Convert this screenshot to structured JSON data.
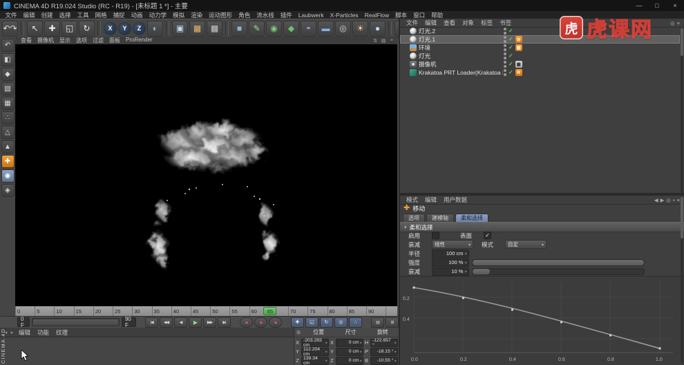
{
  "window": {
    "title": "CINEMA 4D R19.024 Studio (RC - R19) - [未标题 1 *] - 主要",
    "controls": [
      {
        "name": "minimize-button",
        "glyph": "—"
      },
      {
        "name": "maximize-button",
        "glyph": "□"
      },
      {
        "name": "close-button",
        "glyph": "×"
      }
    ]
  },
  "menu_bar": {
    "items": [
      "文件",
      "编辑",
      "创建",
      "选择",
      "工具",
      "网格",
      "捕捉",
      "动画",
      "动力学",
      "模拟",
      "渲染",
      "运动图形",
      "角色",
      "流水线",
      "插件",
      "Laubwerk",
      "X-Particles",
      "RealFlow",
      "脚本",
      "窗口",
      "帮助"
    ]
  },
  "toolbar": {
    "icons": [
      {
        "name": "undo-redo-button",
        "glyph": "↶↷",
        "color": "#dcdcdc"
      },
      {
        "sep": true
      },
      {
        "name": "live-selection-button",
        "glyph": "↖",
        "color": "#ececec"
      },
      {
        "name": "move-tool-button",
        "glyph": "✚",
        "color": "#ececec"
      },
      {
        "name": "scale-tool-button",
        "glyph": "◱",
        "color": "#ececec"
      },
      {
        "name": "rotate-tool-button",
        "glyph": "↻",
        "color": "#ececec"
      },
      {
        "sep": true
      },
      {
        "name": "x-axis-lock-button",
        "glyph": "X",
        "kind": "round"
      },
      {
        "name": "y-axis-lock-button",
        "glyph": "Y",
        "kind": "round"
      },
      {
        "name": "z-axis-lock-button",
        "glyph": "Z",
        "kind": "round"
      },
      {
        "name": "coordinate-system-button",
        "glyph": "◐",
        "color": "#8fc3ea"
      },
      {
        "sep": true
      },
      {
        "name": "render-view-button",
        "glyph": "▣",
        "color": "#bcd9f0"
      },
      {
        "name": "render-picture-viewer-button",
        "glyph": "▦",
        "color": "#e3bb72"
      },
      {
        "name": "render-settings-button",
        "glyph": "▩",
        "color": "#c8c8c8"
      },
      {
        "sep": true
      },
      {
        "name": "add-cube-button",
        "glyph": "■",
        "color": "#8ab4dd"
      },
      {
        "name": "add-spline-button",
        "glyph": "✎",
        "color": "#9fd89f"
      },
      {
        "name": "add-subdivision-button",
        "glyph": "◉",
        "color": "#7ecb7e"
      },
      {
        "name": "add-generator-button",
        "glyph": "◆",
        "color": "#6fbf6f"
      },
      {
        "name": "add-deformer-button",
        "glyph": "◓",
        "color": "#b49ae0"
      },
      {
        "name": "add-floor-button",
        "glyph": "▬",
        "color": "#7fb2e8"
      },
      {
        "name": "add-camera-button",
        "glyph": "◎",
        "color": "#d8d8d8"
      },
      {
        "name": "add-light-button",
        "glyph": "☀",
        "color": "#f2dc8a"
      },
      {
        "name": "add-material-button",
        "glyph": "●",
        "color": "#bcd8f2"
      },
      {
        "sep": true
      },
      {
        "name": "snap-settings-button",
        "glyph": "▦",
        "color": "#e08a8a"
      },
      {
        "name": "grid-settings-button",
        "glyph": "▦",
        "color": "#8ad08a"
      },
      {
        "name": "paint-setup-button",
        "glyph": "✎",
        "color": "#e8c48a"
      }
    ]
  },
  "left_toolbar": {
    "icons": [
      {
        "name": "undo-icon",
        "glyph": "↶"
      },
      {
        "name": "convert-editable-icon",
        "glyph": "◧"
      },
      {
        "name": "model-mode-icon",
        "glyph": "◆"
      },
      {
        "name": "texture-mode-icon",
        "glyph": "▨"
      },
      {
        "name": "workplane-icon",
        "glyph": "▦"
      },
      {
        "name": "points-mode-icon",
        "glyph": "∴"
      },
      {
        "name": "edges-mode-icon",
        "glyph": "△"
      },
      {
        "name": "polygons-mode-icon",
        "glyph": "▲"
      },
      {
        "name": "enable-axis-icon",
        "glyph": "✚",
        "active": true
      },
      {
        "name": "viewport-filter-icon",
        "glyph": "◉",
        "selected": true
      },
      {
        "name": "snap-icon",
        "glyph": "◈"
      }
    ]
  },
  "viewport": {
    "menus": [
      "查看",
      "摄像机",
      "显示",
      "选项",
      "过滤",
      "面板",
      "ProRender"
    ],
    "corner_icons": [
      {
        "name": "swap-views-icon",
        "glyph": "⇅"
      },
      {
        "name": "maximize-view-icon",
        "glyph": "▤"
      },
      {
        "name": "close-view-icon",
        "glyph": "×"
      }
    ]
  },
  "watermark": {
    "logo_char": "虎",
    "text": "虎课网"
  },
  "side_label": "CINEMA 4D",
  "timeline": {
    "ticks": [
      "0",
      "5",
      "10",
      "15",
      "20",
      "25",
      "30",
      "35",
      "40",
      "45",
      "50",
      "55",
      "60",
      "65",
      "70",
      "75",
      "80",
      "85",
      "90"
    ],
    "playhead": "65"
  },
  "transport": {
    "current_frame": "0 F",
    "end_frame": "90 F",
    "buttons": [
      {
        "name": "goto-start-button",
        "glyph": "|◀"
      },
      {
        "name": "prev-key-button",
        "glyph": "◀◀"
      },
      {
        "name": "prev-frame-button",
        "glyph": "◀"
      },
      {
        "name": "play-button",
        "glyph": "▶",
        "accent": true
      },
      {
        "name": "next-frame-button",
        "glyph": "▶▶"
      },
      {
        "name": "goto-end-button",
        "glyph": "▶|"
      }
    ],
    "record_buttons": [
      {
        "name": "record-objects-button",
        "glyph": "●"
      },
      {
        "name": "autokeying-button",
        "glyph": "●"
      },
      {
        "name": "record-selection-button",
        "glyph": "●"
      }
    ],
    "key_buttons": [
      {
        "name": "record-position-button",
        "glyph": "✚"
      },
      {
        "name": "record-scale-button",
        "glyph": "◱"
      },
      {
        "name": "record-rotation-button",
        "glyph": "↻"
      },
      {
        "name": "record-parameter-button",
        "glyph": "◎"
      },
      {
        "name": "record-pla-button",
        "glyph": "∴"
      }
    ],
    "extra_buttons": [
      {
        "name": "playback-rate-button",
        "glyph": "▤"
      },
      {
        "name": "frame-options-button",
        "glyph": "⊞"
      }
    ]
  },
  "material_manager": {
    "nav": [
      "◂",
      "▸"
    ],
    "menus": [
      "编辑",
      "功能",
      "纹理"
    ]
  },
  "coordinates": {
    "icon": "⊞",
    "headers": [
      "位置",
      "尺寸",
      "旋转"
    ],
    "position": {
      "labels": [
        "X",
        "Y",
        "Z"
      ],
      "values": [
        "-203.283 cm",
        "112.204 cm",
        "139.34 cm"
      ]
    },
    "size": {
      "labels": [
        "X",
        "Y",
        "Z"
      ],
      "values": [
        "0 cm",
        "0 cm",
        "0 cm"
      ]
    },
    "rotation": {
      "labels": [
        "H",
        "P",
        "B"
      ],
      "values": [
        "-122.657 °",
        "-18.15 °",
        "-10.55 °"
      ]
    }
  },
  "object_manager": {
    "menus": [
      "文件",
      "编辑",
      "查看",
      "对象",
      "标签",
      "书签"
    ],
    "right_icons": [
      {
        "name": "search-icon",
        "glyph": "◎"
      },
      {
        "name": "menu-icon",
        "glyph": "≡"
      }
    ],
    "items": [
      {
        "name": "灯光.2",
        "icon": "light"
      },
      {
        "name": "灯光.1",
        "icon": "light",
        "selected": true,
        "tag": "target",
        "tag_text": "◎"
      },
      {
        "name": "环境",
        "icon": "environment",
        "tag": "compositing",
        "tag_text": "▨"
      },
      {
        "name": "灯光",
        "icon": "light"
      },
      {
        "name": "摄像机",
        "icon": "camera",
        "tag": "protection",
        "tag_text": "▣"
      },
      {
        "name": "Krakatoa PRT Loader(Krakatoa PRT 加载)",
        "icon": "krakatoa",
        "tag": "krakatoa",
        "tag_text": "R"
      }
    ]
  },
  "attributes": {
    "menus": [
      "模式",
      "编辑",
      "用户数据"
    ],
    "right_icons": [
      {
        "name": "back-arrow-icon",
        "glyph": "◀"
      },
      {
        "name": "forward-arrow-icon",
        "glyph": "▶"
      },
      {
        "name": "search-icon",
        "glyph": "◎"
      },
      {
        "name": "lock-icon",
        "glyph": "▪"
      },
      {
        "name": "menu-icon",
        "glyph": "≡"
      }
    ],
    "tool_icon": "✚",
    "tool_label": "移动",
    "tabs": [
      "选项",
      "建模轴",
      "柔和选择"
    ],
    "active_tab": "柔和选择",
    "section_title": "柔和选择",
    "fields": {
      "enable_label": "启用",
      "enable_check": "",
      "surface_label": "表面",
      "surface_check": "✓",
      "falloff_label": "衰减",
      "falloff_value": "线性",
      "mode_label": "模式",
      "mode_value": "自定",
      "radius_label": "半径",
      "radius_value": "100 cm",
      "strength_label": "强度",
      "strength_value": "100 %",
      "strength_pct": 100,
      "decay_label": "衰减",
      "decay_value": "10 %",
      "decay_pct": 10
    },
    "curve": {
      "y_labels": [
        "0.2",
        "0.4"
      ],
      "x_labels": [
        "0.0",
        "0.2",
        "0.4",
        "0.6",
        "0.8",
        "1.0"
      ]
    }
  }
}
